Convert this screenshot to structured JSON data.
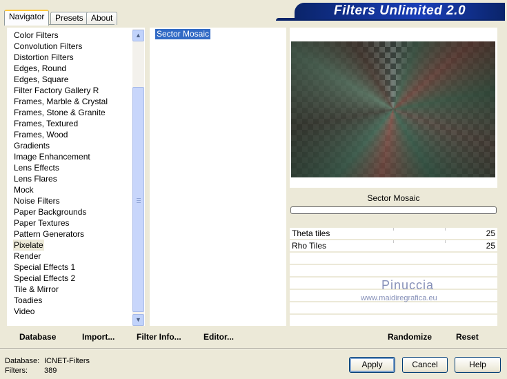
{
  "tabs": [
    "Navigator",
    "Presets",
    "About"
  ],
  "banner_title": "Filters Unlimited 2.0",
  "categories": [
    "Color Filters",
    "Convolution Filters",
    "Distortion Filters",
    "Edges, Round",
    "Edges, Square",
    "Filter Factory Gallery R",
    "Frames, Marble & Crystal",
    "Frames, Stone & Granite",
    "Frames, Textured",
    "Frames, Wood",
    "Gradients",
    "Image Enhancement",
    "Lens Effects",
    "Lens Flares",
    "Mock",
    "Noise Filters",
    "Paper Backgrounds",
    "Paper Textures",
    "Pattern Generators",
    "Pixelate",
    "Render",
    "Special Effects 1",
    "Special Effects 2",
    "Tile & Mirror",
    "Toadies",
    "Video"
  ],
  "selected_category": "Pixelate",
  "filters": [
    "Sector Mosaic"
  ],
  "filter_name": "Sector Mosaic",
  "params": [
    {
      "label": "Theta tiles",
      "value": "25"
    },
    {
      "label": "Rho Tiles",
      "value": "25"
    }
  ],
  "watermark": {
    "line1": "Pinuccia",
    "line2": "www.maidiregrafica.eu"
  },
  "toolbar_left": {
    "database": "Database",
    "import": "Import...",
    "filter_info": "Filter Info...",
    "editor": "Editor..."
  },
  "toolbar_right": {
    "randomize": "Randomize",
    "reset": "Reset"
  },
  "status": {
    "database_label": "Database:",
    "database_value": "ICNET-Filters",
    "filters_label": "Filters:",
    "filters_value": "389"
  },
  "buttons": {
    "apply": "Apply",
    "cancel": "Cancel",
    "help": "Help"
  }
}
